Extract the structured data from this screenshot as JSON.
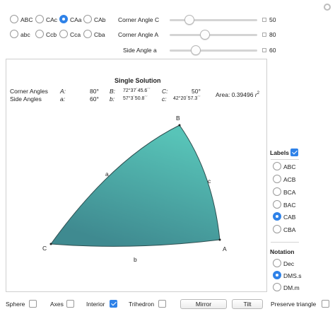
{
  "settings_icon": "gear-icon",
  "orderings": [
    {
      "label": "ABC",
      "selected": false
    },
    {
      "label": "CAc",
      "selected": false
    },
    {
      "label": "CAa",
      "selected": true
    },
    {
      "label": "CAb",
      "selected": false
    },
    {
      "label": "abc",
      "selected": false
    },
    {
      "label": "Ccb",
      "selected": false
    },
    {
      "label": "Cca",
      "selected": false
    },
    {
      "label": "Cba",
      "selected": false
    }
  ],
  "sliders": [
    {
      "label": "Corner Angle C",
      "value": "50",
      "fraction": 0.28
    },
    {
      "label": "Corner Angle A",
      "value": "80",
      "fraction": 0.42
    },
    {
      "label": "Side Angle a",
      "value": "60",
      "fraction": 0.32
    }
  ],
  "solution": {
    "title": "Single Solution",
    "corner_label": "Corner Angles",
    "side_label": "Side Angles",
    "A_name": "A:",
    "A_val": "80°",
    "B_name": "B:",
    "B_val": "72°37´45.6´´",
    "C_name": "C:",
    "C_val": "50°",
    "a_name": "a:",
    "a_val": "60°",
    "b_name": "b:",
    "b_val": "57°3´50.8´´",
    "c_name": "c:",
    "c_val": "42°20´57.3´´",
    "area_label": "Area:",
    "area_val": "0.39496",
    "area_unit": "r",
    "area_exp": "2"
  },
  "triangle": {
    "vertex_A": "A",
    "vertex_B": "B",
    "vertex_C": "C",
    "side_a": "a",
    "side_b": "b",
    "side_c": "c",
    "fill_top": "#58c4b8",
    "fill_bottom": "#3f8a90"
  },
  "labels_panel": {
    "title": "Labels",
    "checked": true,
    "options": [
      {
        "label": "ABC",
        "selected": false
      },
      {
        "label": "ACB",
        "selected": false
      },
      {
        "label": "BCA",
        "selected": false
      },
      {
        "label": "BAC",
        "selected": false
      },
      {
        "label": "CAB",
        "selected": true
      },
      {
        "label": "CBA",
        "selected": false
      }
    ]
  },
  "notation_panel": {
    "title": "Notation",
    "options": [
      {
        "label": "Dec",
        "selected": false
      },
      {
        "label": "DMS.s",
        "selected": true
      },
      {
        "label": "DM.m",
        "selected": false
      }
    ]
  },
  "bottom_bar": {
    "sphere": {
      "label": "Sphere",
      "checked": false
    },
    "axes": {
      "label": "Axes",
      "checked": false
    },
    "interior": {
      "label": "Interior",
      "checked": true
    },
    "trihedron": {
      "label": "Trihedron",
      "checked": false
    },
    "mirror": "Mirror",
    "tilt": "Tilt",
    "preserve": {
      "label": "Preserve triangle",
      "checked": false
    }
  },
  "accent_color": "#2f82e8"
}
